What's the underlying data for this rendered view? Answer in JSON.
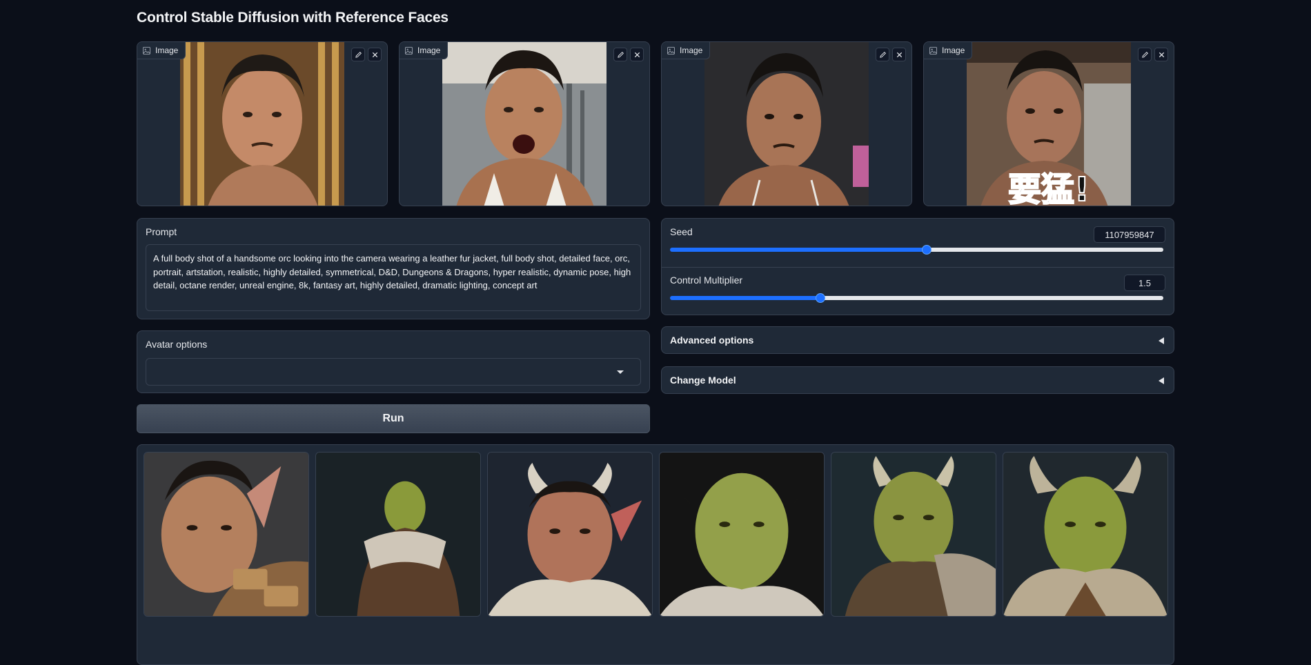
{
  "title": "Control Stable Diffusion with Reference Faces",
  "image_inputs": [
    {
      "label": "Image",
      "edit_icon": "pencil-icon",
      "clear_icon": "close-icon"
    },
    {
      "label": "Image",
      "edit_icon": "pencil-icon",
      "clear_icon": "close-icon"
    },
    {
      "label": "Image",
      "edit_icon": "pencil-icon",
      "clear_icon": "close-icon"
    },
    {
      "label": "Image",
      "edit_icon": "pencil-icon",
      "clear_icon": "close-icon",
      "overlay_text": "要猛!"
    }
  ],
  "prompt": {
    "label": "Prompt",
    "value": "A full body shot of a handsome orc looking into the camera wearing a leather fur jacket, full body shot, detailed face, orc, portrait, artstation, realistic, highly detailed, symmetrical, D&D, Dungeons & Dragons, hyper realistic, dynamic pose, high detail, octane render, unreal engine, 8k, fantasy art, highly detailed, dramatic lighting, concept art"
  },
  "seed": {
    "label": "Seed",
    "value": "1107959847",
    "slider_fraction": 0.52
  },
  "control_multiplier": {
    "label": "Control Multiplier",
    "value": "1.5",
    "slider_fraction": 0.305
  },
  "avatar_options": {
    "label": "Avatar options",
    "selected": ""
  },
  "advanced_options": {
    "label": "Advanced options"
  },
  "change_model": {
    "label": "Change Model"
  },
  "run_button": {
    "label": "Run"
  },
  "colors": {
    "accent": "#1d6fff",
    "background": "#0b0f19",
    "panel": "#1f2937"
  },
  "gallery_count": 6
}
